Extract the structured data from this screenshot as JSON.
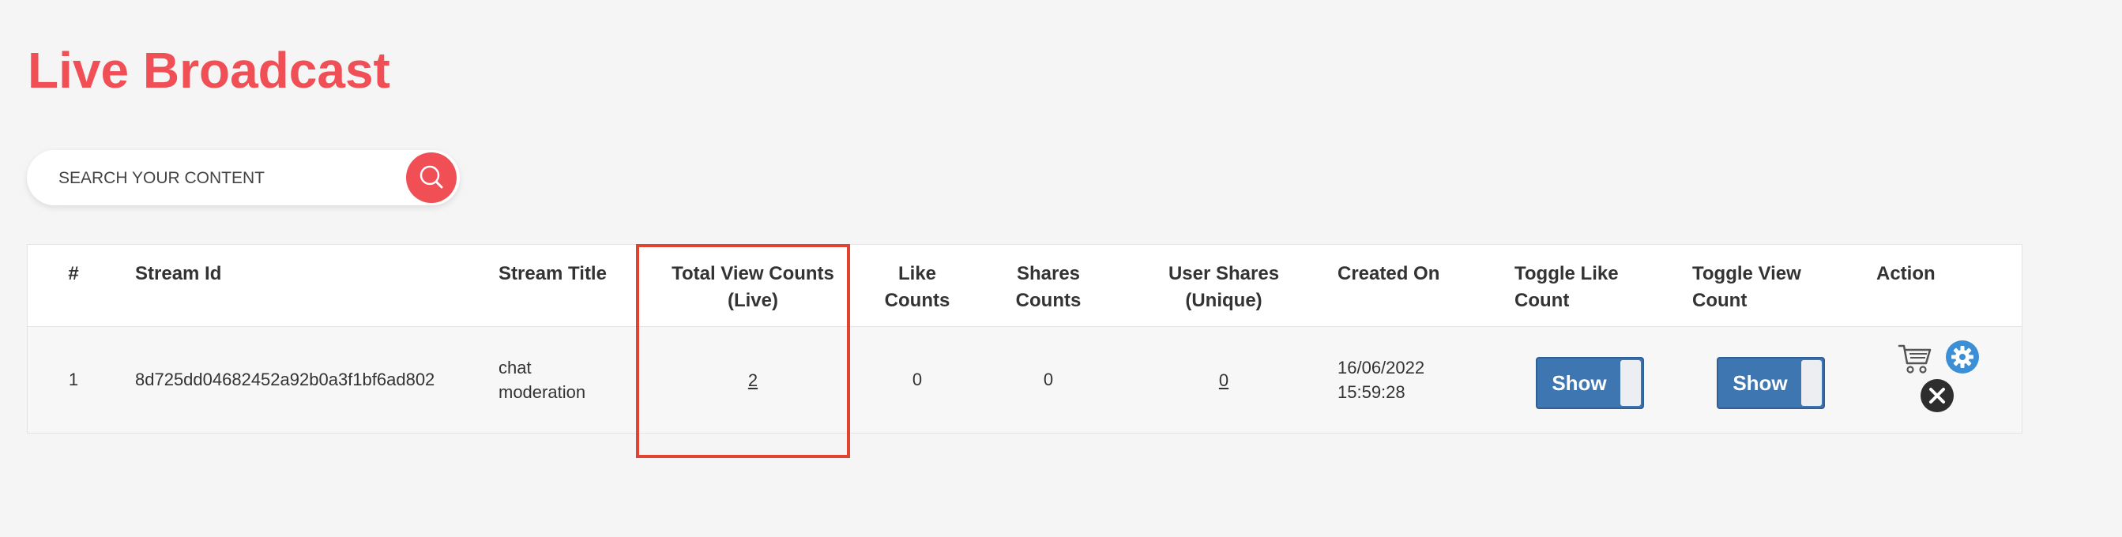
{
  "page": {
    "title": "Live Broadcast"
  },
  "search": {
    "placeholder": "SEARCH YOUR CONTENT",
    "value": ""
  },
  "table": {
    "headers": {
      "index": "#",
      "stream_id": "Stream Id",
      "stream_title": "Stream Title",
      "total_view_counts_line1": "Total View Counts",
      "total_view_counts_line2": "(Live)",
      "like_counts_line1": "Like",
      "like_counts_line2": "Counts",
      "shares_counts_line1": "Shares",
      "shares_counts_line2": "Counts",
      "user_shares_line1": "User Shares",
      "user_shares_line2": "(Unique)",
      "created_on": "Created On",
      "toggle_like_line1": "Toggle Like",
      "toggle_like_line2": "Count",
      "toggle_view_line1": "Toggle View",
      "toggle_view_line2": "Count",
      "action": "Action"
    },
    "rows": [
      {
        "index": "1",
        "stream_id": "8d725dd04682452a92b0a3f1bf6ad802",
        "stream_title_line1": "chat",
        "stream_title_line2": "moderation",
        "total_view_counts": "2",
        "like_counts": "0",
        "shares_counts": "0",
        "user_shares": "0",
        "created_date": "16/06/2022",
        "created_time": "15:59:28",
        "toggle_like_label": "Show",
        "toggle_view_label": "Show"
      }
    ]
  },
  "icons": {
    "search": "search-icon",
    "cart": "cart-icon",
    "settings": "gear-icon",
    "delete": "close-icon"
  },
  "colors": {
    "accent": "#ef4f55",
    "toggle": "#3e76b1",
    "settings_icon": "#3b8fd6",
    "delete_icon": "#2e2e2e",
    "highlight": "#e0432f"
  }
}
